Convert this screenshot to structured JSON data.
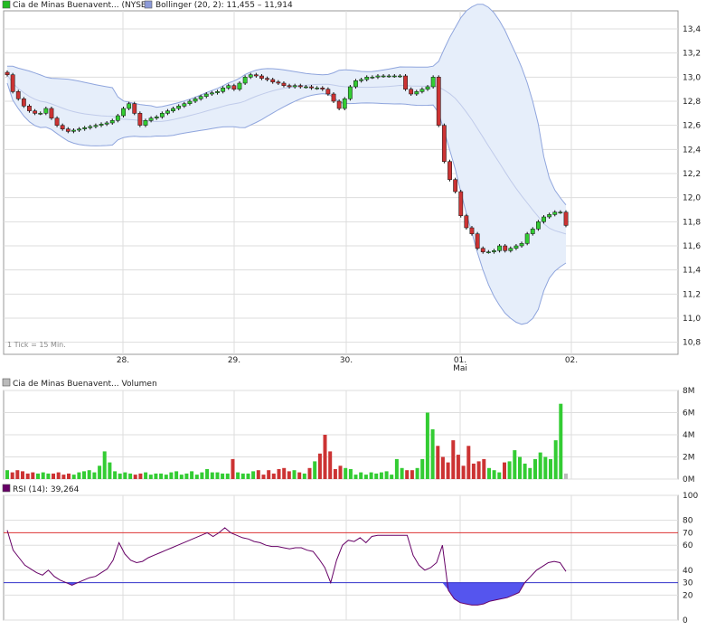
{
  "price_legend": {
    "series_label": "Cia de Minas Buenavent... (NYSE)",
    "series_color": "#22bb22",
    "bollinger_label": "Bollinger (20, 2): 11,455 – 11,914",
    "bollinger_color": "#8c9ad8"
  },
  "volume_legend": {
    "label": "Cia de Minas Buenavent... Volumen",
    "color": "#bbbbbb"
  },
  "rsi_legend": {
    "label": "RSI (14): 39,264",
    "color": "#660066"
  },
  "tick_note": "1 Tick = 15 Min.",
  "x_labels": [
    "28.",
    "29.",
    "30.",
    "01.",
    "02."
  ],
  "x_sublabel": "Mai",
  "colors": {
    "up": "#33cc33",
    "down": "#cc3333",
    "grid": "#dddddd",
    "band_fill": "#e6eefa",
    "band_line": "#8fa5dd",
    "rsi_line": "#660066",
    "overbought": "#dd3333",
    "oversold": "#3333cc",
    "oversold_fill": "#5555ee"
  },
  "chart_data": [
    {
      "type": "candlestick",
      "name": "price",
      "x_labels": [
        "28.",
        "29.",
        "30.",
        "01.",
        "02."
      ],
      "ylim": [
        10.7,
        13.55
      ],
      "y_ticks": [
        10.8,
        11.0,
        11.2,
        11.4,
        11.6,
        11.8,
        12.0,
        12.2,
        12.4,
        12.6,
        12.8,
        13.0,
        13.2,
        13.4
      ],
      "y_tick_labels": [
        "10,8",
        "11,0",
        "11,2",
        "11,4",
        "11,6",
        "11,8",
        "12,0",
        "12,2",
        "12,4",
        "12,6",
        "12,8",
        "13,0",
        "13,2",
        "13,4"
      ],
      "close": [
        13.02,
        12.88,
        12.82,
        12.76,
        12.72,
        12.7,
        12.7,
        12.74,
        12.66,
        12.6,
        12.57,
        12.55,
        12.56,
        12.57,
        12.58,
        12.59,
        12.6,
        12.61,
        12.62,
        12.64,
        12.68,
        12.74,
        12.78,
        12.7,
        12.6,
        12.64,
        12.66,
        12.67,
        12.7,
        12.72,
        12.74,
        12.76,
        12.78,
        12.8,
        12.82,
        12.84,
        12.86,
        12.87,
        12.88,
        12.91,
        12.93,
        12.9,
        12.95,
        13.0,
        13.02,
        13.01,
        12.99,
        12.98,
        12.96,
        12.95,
        12.93,
        12.92,
        12.93,
        12.92,
        12.92,
        12.91,
        12.91,
        12.9,
        12.86,
        12.8,
        12.74,
        12.82,
        12.92,
        12.97,
        12.98,
        13.0,
        13.0,
        13.01,
        13.01,
        13.01,
        13.01,
        13.01,
        12.9,
        12.86,
        12.88,
        12.9,
        12.92,
        13.0,
        12.6,
        12.3,
        12.15,
        12.05,
        11.85,
        11.75,
        11.7,
        11.58,
        11.55,
        11.55,
        11.56,
        11.6,
        11.56,
        11.58,
        11.6,
        11.62,
        11.7,
        11.74,
        11.8,
        11.84,
        11.86,
        11.88,
        11.88,
        11.77
      ],
      "volume": [
        0.8,
        0.6,
        0.8,
        0.7,
        0.5,
        0.6,
        0.5,
        0.6,
        0.5,
        0.5,
        0.6,
        0.4,
        0.5,
        0.4,
        0.6,
        0.7,
        0.8,
        0.6,
        1.2,
        2.5,
        1.5,
        0.7,
        0.5,
        0.6,
        0.5,
        0.4,
        0.5,
        0.6,
        0.4,
        0.5,
        0.5,
        0.4,
        0.6,
        0.7,
        0.4,
        0.5,
        0.7,
        0.4,
        0.6,
        0.9,
        0.6,
        0.6,
        0.5,
        0.5,
        1.8,
        0.6,
        0.5,
        0.5,
        0.7,
        0.8,
        0.4,
        0.8,
        0.5,
        0.9,
        1.0,
        0.7,
        0.8,
        0.6,
        0.5,
        1.0,
        1.6,
        2.3,
        4.0,
        2.5,
        0.9,
        1.2,
        1.0,
        0.9,
        0.4,
        0.6,
        0.4,
        0.6,
        0.5,
        0.6,
        0.7,
        0.4,
        1.8,
        1.0,
        0.8,
        0.8,
        1.0,
        1.8,
        6.0,
        4.5,
        3.0,
        2.0,
        1.5,
        3.5,
        2.2,
        1.2,
        3.0,
        1.4,
        1.6,
        1.8,
        1.0,
        0.8,
        0.6,
        1.5,
        1.6,
        2.6,
        2.0,
        1.4,
        1.0,
        1.8,
        2.4,
        2.0,
        1.8,
        3.5,
        6.8,
        0.5
      ],
      "volume_ylim": [
        0,
        8
      ],
      "volume_ticks": [
        0,
        2,
        4,
        6,
        8
      ],
      "volume_tick_labels": [
        "0M",
        "2M",
        "4M",
        "6M",
        "8M"
      ]
    },
    {
      "type": "line",
      "name": "RSI (14)",
      "ylim": [
        0,
        100
      ],
      "y_ticks": [
        0,
        20,
        30,
        40,
        60,
        70,
        80,
        100
      ],
      "y_tick_labels": [
        "0",
        "20",
        "30",
        "40",
        "60",
        "70",
        "80",
        "100"
      ],
      "overbought": 70,
      "oversold": 30,
      "values": [
        72,
        56,
        50,
        44,
        41,
        38,
        36,
        40,
        35,
        32,
        30,
        28,
        30,
        32,
        34,
        35,
        38,
        41,
        48,
        62,
        53,
        48,
        46,
        47,
        50,
        52,
        54,
        56,
        58,
        60,
        62,
        64,
        66,
        68,
        70,
        67,
        70,
        74,
        70,
        68,
        66,
        65,
        63,
        62,
        60,
        59,
        59,
        58,
        57,
        58,
        58,
        56,
        55,
        49,
        42,
        30,
        48,
        60,
        64,
        63,
        66,
        62,
        67,
        68,
        68,
        68,
        68,
        68,
        68,
        52,
        44,
        40,
        42,
        46,
        60,
        24,
        17,
        14,
        13,
        12,
        12,
        13,
        15,
        16,
        17,
        18,
        20,
        22,
        30,
        35,
        40,
        43,
        46,
        47,
        46,
        39
      ]
    }
  ]
}
